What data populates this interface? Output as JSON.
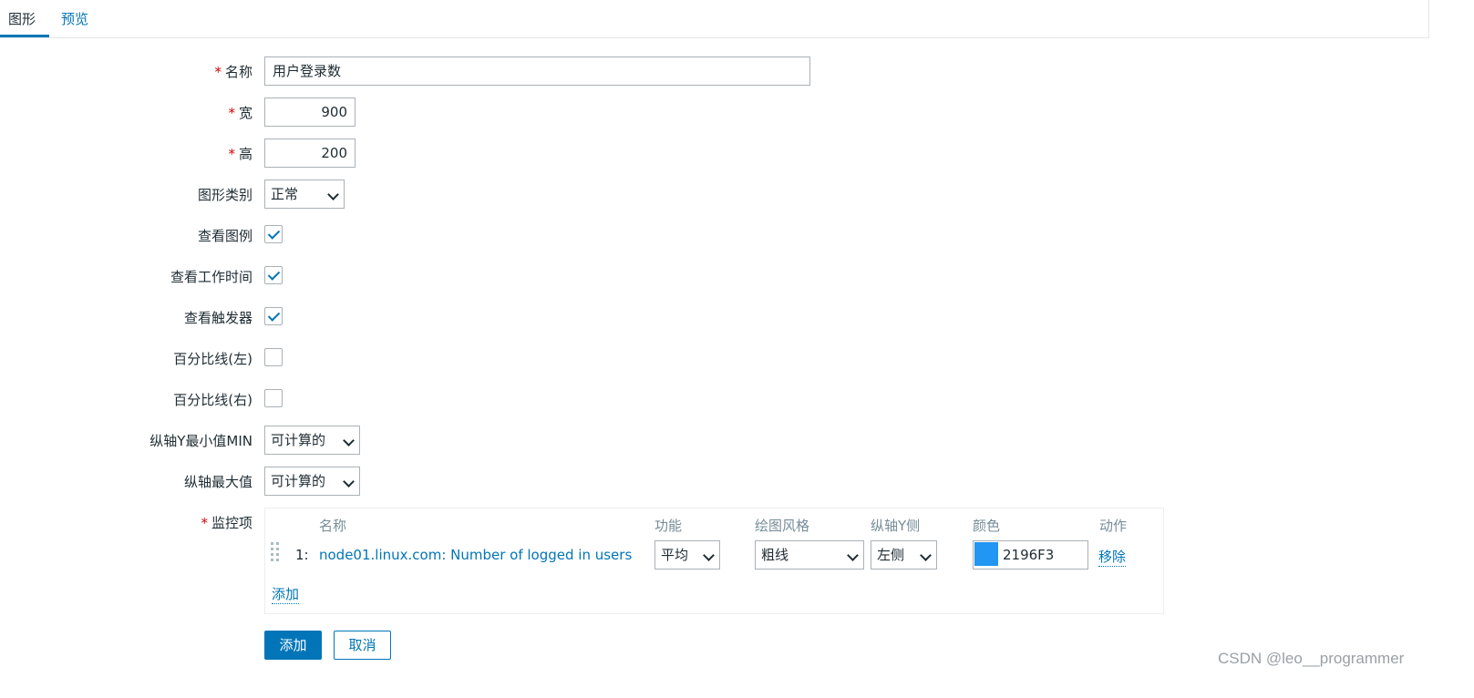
{
  "tabs": {
    "graph": "图形",
    "preview": "预览"
  },
  "required_mark": "*",
  "fields": {
    "name": {
      "label": "名称",
      "value": "用户登录数"
    },
    "width": {
      "label": "宽",
      "value": "900"
    },
    "height": {
      "label": "高",
      "value": "200"
    },
    "graph_type": {
      "label": "图形类别",
      "value": "正常"
    },
    "show_legend": {
      "label": "查看图例",
      "checked": true
    },
    "show_working_time": {
      "label": "查看工作时间",
      "checked": true
    },
    "show_triggers": {
      "label": "查看触发器",
      "checked": true
    },
    "percentile_left": {
      "label": "百分比线(左)",
      "checked": false
    },
    "percentile_right": {
      "label": "百分比线(右)",
      "checked": false
    },
    "y_min": {
      "label": "纵轴Y最小值MIN",
      "value": "可计算的"
    },
    "y_max": {
      "label": "纵轴最大值",
      "value": "可计算的"
    }
  },
  "items": {
    "label": "监控项",
    "headers": {
      "name": "名称",
      "function": "功能",
      "draw_style": "绘图风格",
      "y_axis": "纵轴Y侧",
      "color": "颜色",
      "action": "动作"
    },
    "rows": [
      {
        "index": "1:",
        "name": "node01.linux.com: Number of logged in users",
        "function": "平均",
        "draw_style": "粗线",
        "y_axis": "左侧",
        "color": "2196F3",
        "swatch_color": "#2196F3",
        "remove": "移除"
      }
    ],
    "add_link": "添加"
  },
  "buttons": {
    "add": "添加",
    "cancel": "取消"
  },
  "watermark": "CSDN @leo__programmer",
  "icons": {
    "checkbox_tick": "check-icon",
    "dropdown": "chevron-down-icon",
    "drag": "drag-handle-icon"
  }
}
